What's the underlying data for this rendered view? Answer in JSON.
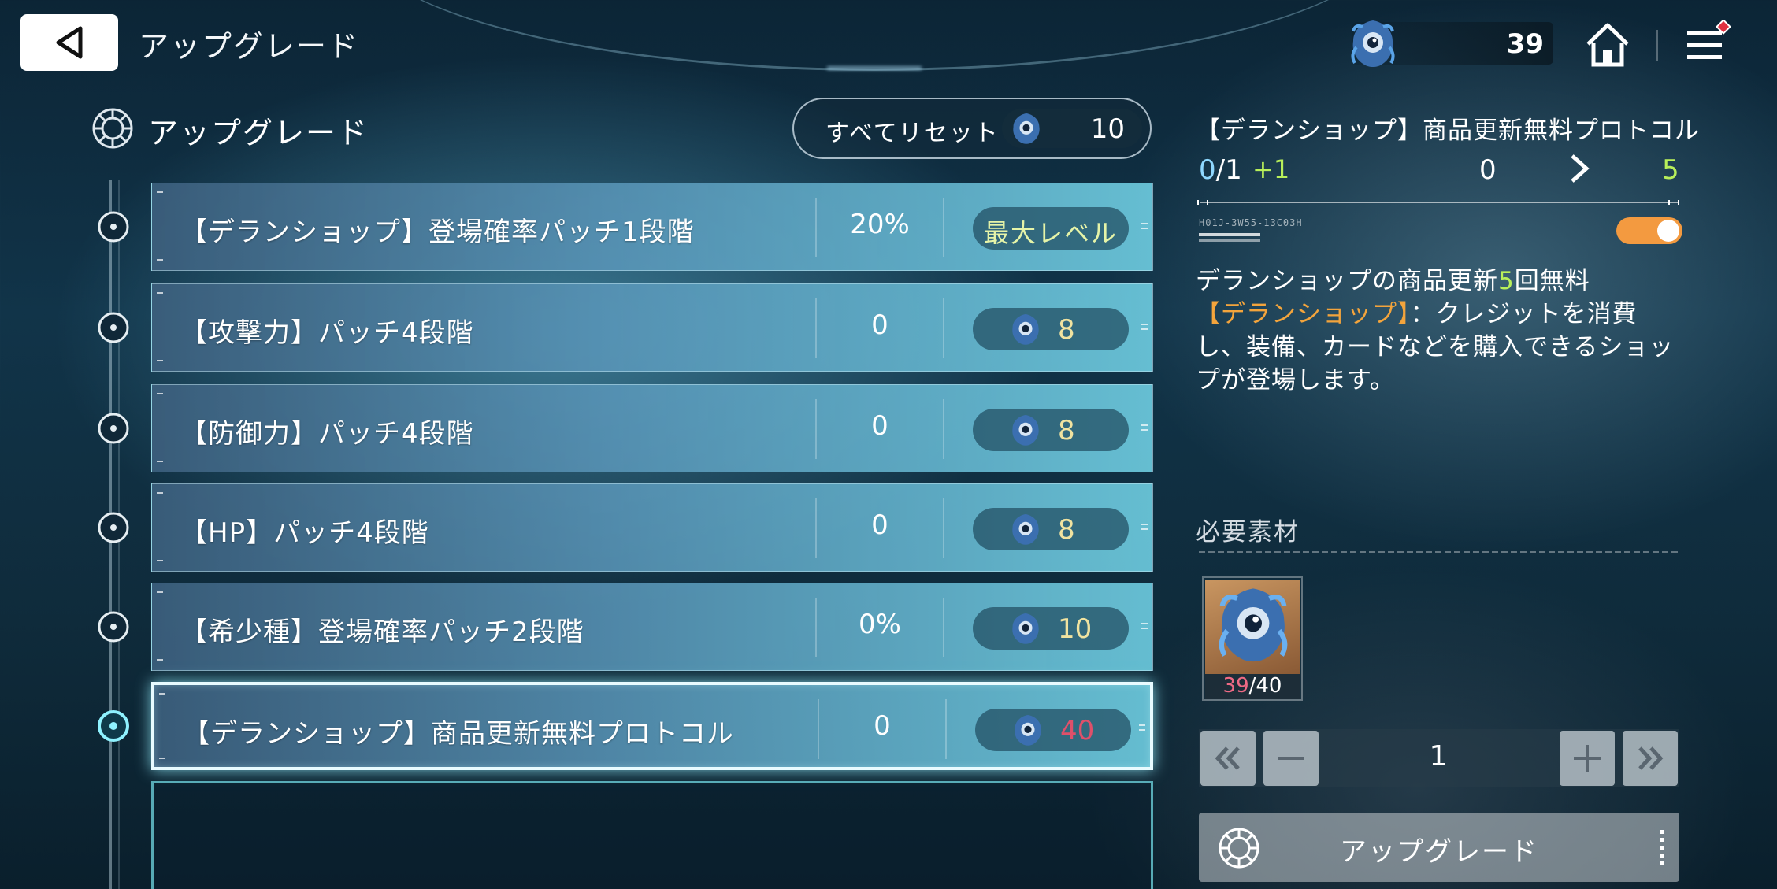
{
  "header": {
    "title": "アップグレード",
    "currency_amount": "39"
  },
  "section": {
    "title": "アップグレード",
    "reset_label": "すべてリセット",
    "reset_cost": "10"
  },
  "rows": [
    {
      "name": "【デランショップ】登場確率パッチ1段階",
      "value": "20%",
      "button_label": "最大レベル",
      "max": true
    },
    {
      "name": "【攻撃力】パッチ4段階",
      "value": "0",
      "cost": "8"
    },
    {
      "name": "【防御力】パッチ4段階",
      "value": "0",
      "cost": "8"
    },
    {
      "name": "【HP】パッチ4段階",
      "value": "0",
      "cost": "8"
    },
    {
      "name": "【希少種】登場確率パッチ2段階",
      "value": "0%",
      "cost": "10"
    },
    {
      "name": "【デランショップ】商品更新無料プロトコル",
      "value": "0",
      "cost": "40",
      "selected": true
    }
  ],
  "detail": {
    "title": "【デランショップ】商品更新無料プロトコル",
    "level_current": "0",
    "level_slash_max": "/1",
    "level_increment": "+1",
    "value_current": "0",
    "value_next": "5",
    "code_text": "H01J-3W55-13C03H",
    "toggle_on": true,
    "description_pre": "デランショップの商品更新",
    "description_number": "5",
    "description_post": "回無料",
    "description_highlight": "【デランショップ】",
    "description_body": "：クレジットを消費し、装備、カードなどを購入できるショップが登場します。",
    "materials_title": "必要素材",
    "material_have": "39",
    "material_need": "/40",
    "quantity": "1",
    "upgrade_label": "アップグレード"
  },
  "colors": {
    "accent_green": "#b8ef5a",
    "accent_orange": "#f3a43c",
    "insufficient_red": "#e0506a",
    "toggle_orange": "#f39a40"
  },
  "icons": {
    "back": "back-triangle-icon",
    "currency": "blue-eye-creature-icon",
    "home": "home-icon",
    "menu": "hamburger-menu-icon",
    "section": "target-reticle-icon"
  }
}
